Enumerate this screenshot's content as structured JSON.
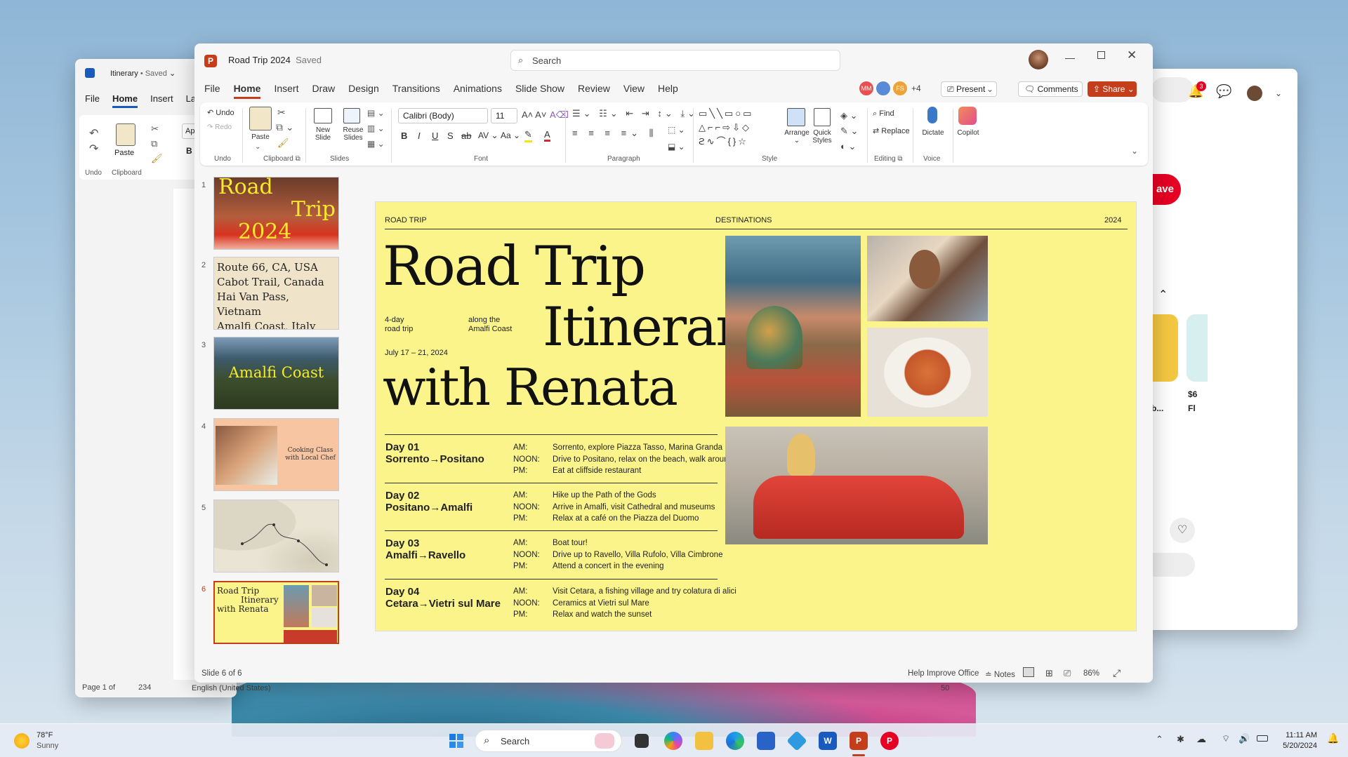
{
  "word": {
    "title": "Itinerary",
    "saved": "• Saved",
    "menu": [
      "File",
      "Home",
      "Insert",
      "La"
    ],
    "active": "Home",
    "undo_grp": "Undo",
    "clipboard_grp": "Clipboard",
    "paste": "Paste",
    "font_hint": "Apt",
    "bold": "B",
    "status_page": "Page 1 of",
    "status_words": "234",
    "status_lang": "English (United States)",
    "status_zoom": "50"
  },
  "ppt": {
    "title": "Road Trip 2024",
    "saved": "Saved",
    "search_placeholder": "Search",
    "menu": [
      "File",
      "Home",
      "Insert",
      "Draw",
      "Design",
      "Transitions",
      "Animations",
      "Slide Show",
      "Review",
      "View",
      "Help"
    ],
    "active_tab": "Home",
    "collab": {
      "a": "MM",
      "c": "FS",
      "more": "+4"
    },
    "present": "Present",
    "comments": "Comments",
    "share": "Share",
    "ribbon": {
      "undo": "Undo",
      "redo": "Redo",
      "undo_grp": "Undo",
      "paste": "Paste",
      "clipboard_grp": "Clipboard",
      "new_slide": "New\nSlide",
      "reuse": "Reuse\nSlides",
      "slides_grp": "Slides",
      "font_name": "Calibri (Body)",
      "font_size": "11",
      "font_grp": "Font",
      "para_grp": "Paragraph",
      "arrange": "Arrange",
      "quick_styles": "Quick\nStyles",
      "style_grp": "Style",
      "find": "Find",
      "replace": "Replace",
      "editing_grp": "Editing",
      "dictate": "Dictate",
      "voice_grp": "Voice",
      "copilot": "Copilot"
    },
    "thumbs": [
      {
        "n": "1",
        "lines": [
          "Road",
          "Trip",
          "2024"
        ]
      },
      {
        "n": "2",
        "lines": [
          "Route 66, CA, USA",
          "Cabot Trail, Canada",
          "Hai Van Pass, Vietnam",
          "Amalfi Coast, Italy"
        ]
      },
      {
        "n": "3",
        "lines": [
          "Amalfi Coast"
        ]
      },
      {
        "n": "4",
        "lines": [
          "Cooking Class",
          "with Local Chef"
        ]
      },
      {
        "n": "5",
        "lines": []
      },
      {
        "n": "6",
        "lines": [
          "Road Trip",
          "Itinerary",
          "with Renata"
        ]
      }
    ],
    "slide": {
      "hdr_left": "ROAD TRIP",
      "hdr_mid": "DESTINATIONS",
      "hdr_right": "2024",
      "title1": "Road Trip",
      "title2": "Itinerary",
      "title3": "with Renata",
      "sub1": "4-day\nroad trip",
      "sub2": "along the\nAmalfi Coast",
      "dates": "July 17 – 21, 2024",
      "days": [
        {
          "d": "Day 01",
          "r": "Sorrento→Positano",
          "acts": [
            "Sorrento, explore Piazza Tasso, Marina Granda",
            "Drive to Positano, relax on the beach, walk around.",
            "Eat at cliffside restaurant"
          ]
        },
        {
          "d": "Day 02",
          "r": "Positano→Amalfi",
          "acts": [
            "Hike up the Path of the Gods",
            "Arrive in Amalfi, visit Cathedral and museums",
            "Relax at a café on the Piazza del Duomo"
          ]
        },
        {
          "d": "Day 03",
          "r": "Amalfi→Ravello",
          "acts": [
            "Boat tour!",
            "Drive up to Ravello, Villa Rufolo, Villa Cimbrone",
            "Attend a concert in the evening"
          ]
        },
        {
          "d": "Day 04",
          "r": "Cetara→Vietri sul Mare",
          "acts": [
            "Visit Cetara, a fishing village and try colatura di alici",
            "Ceramics at Vietri sul Mare",
            "Relax and watch the sunset"
          ]
        }
      ],
      "slots": "AM:\nNOON:\nPM:"
    },
    "status": {
      "slide": "Slide 6 of 6",
      "help": "Help Improve Office",
      "notes": "Notes",
      "zoom": "86%"
    }
  },
  "pinterest": {
    "save": "ave",
    "badge": "3",
    "price": "$6",
    "fl": "Fl",
    "b": "b..."
  },
  "taskbar": {
    "temp": "78°F",
    "weather": "Sunny",
    "search": "Search",
    "time": "11:11 AM",
    "date": "5/20/2024"
  }
}
